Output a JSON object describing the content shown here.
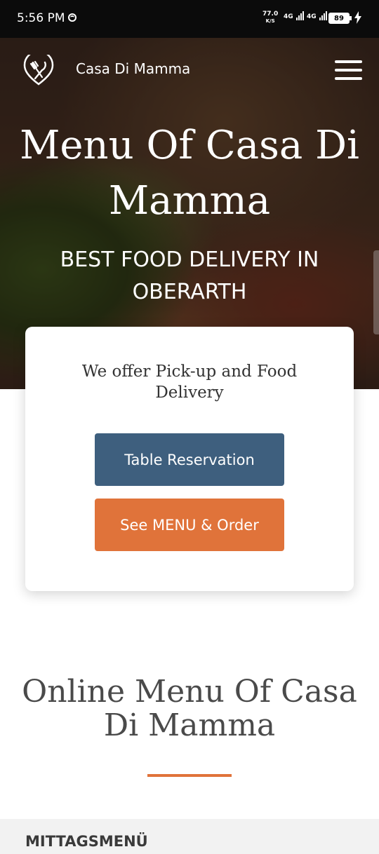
{
  "status_bar": {
    "time": "5:56 PM",
    "net_speed_value": "77.0",
    "net_speed_unit": "K/S",
    "signal1_label": "4G",
    "signal2_label": "4G",
    "battery": "89"
  },
  "header": {
    "brand": "Casa Di Mamma"
  },
  "hero": {
    "title": "Menu Of Casa Di Mamma",
    "subtitle": "BEST FOOD DELIVERY IN OBERARTH"
  },
  "card": {
    "text": "We offer Pick-up and Food Delivery",
    "reserve_label": "Table Reservation",
    "order_label": "See MENU & Order"
  },
  "menu_section": {
    "title": "Online Menu Of Casa Di Mamma",
    "first_category": "MITTAGSMENÜ"
  },
  "colors": {
    "primary_blue": "#3e5f7e",
    "accent_orange": "#e0733a",
    "title_gray": "#4a4a4a"
  },
  "icons": {
    "logo": "fork-knife-icon",
    "menu": "hamburger-menu-icon",
    "battery": "battery-icon",
    "charging": "lightning-bolt-icon"
  }
}
